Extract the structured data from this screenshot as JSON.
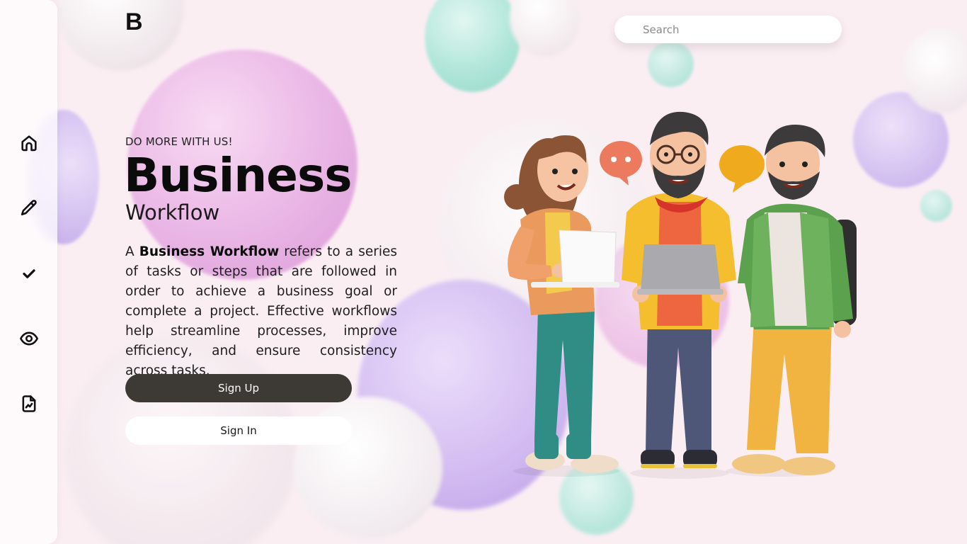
{
  "brand": {
    "logo": "B"
  },
  "search": {
    "placeholder": "Search"
  },
  "sidebar": {
    "items": [
      {
        "name": "home",
        "icon": "home-icon"
      },
      {
        "name": "edit",
        "icon": "pencil-icon"
      },
      {
        "name": "tasks",
        "icon": "check-icon"
      },
      {
        "name": "view",
        "icon": "eye-icon"
      },
      {
        "name": "reports",
        "icon": "chart-file-icon"
      }
    ]
  },
  "hero": {
    "eyebrow": "DO MORE WITH US!",
    "title": "Business",
    "subtitle": "Workflow",
    "desc_prefix": "A ",
    "desc_bold": "Business Workflow",
    "desc_rest": " refers to a series of tasks or steps that are followed in order to achieve a business goal or complete a project. Effective workflows help streamline processes, improve efficiency, and ensure consistency across tasks.",
    "signup_label": "Sign Up",
    "signin_label": "Sign In"
  },
  "colors": {
    "background": "#fbeef3",
    "primary_button": "#3d3a36",
    "text": "#111111"
  }
}
